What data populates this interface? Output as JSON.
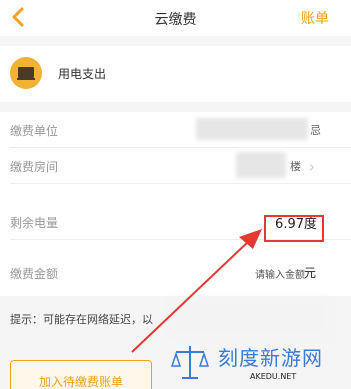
{
  "nav": {
    "title": "云缴费",
    "right": "账单",
    "back_icon": "chevron-left-icon",
    "accent": "#f0a21b"
  },
  "payee": {
    "label": "用电支出",
    "icon": "tv-icon"
  },
  "form": {
    "unit_label": "缴费单位",
    "unit_value_tail": "忌",
    "room_label": "缴费房间",
    "room_value_tail": "楼",
    "remaining_label": "剩余电量",
    "remaining_value": "6.97度",
    "amount_label": "缴费金额",
    "amount_placeholder": "请输入金额",
    "amount_unit": "元"
  },
  "tip": "提示：可能存在网络延迟，以",
  "pending_button": "加入待缴费账单",
  "watermark": {
    "text": "刻度新游网",
    "url": "AKEDU.NET"
  },
  "colors": {
    "highlight": "#e53935",
    "watermark": "#3b7bd4"
  }
}
